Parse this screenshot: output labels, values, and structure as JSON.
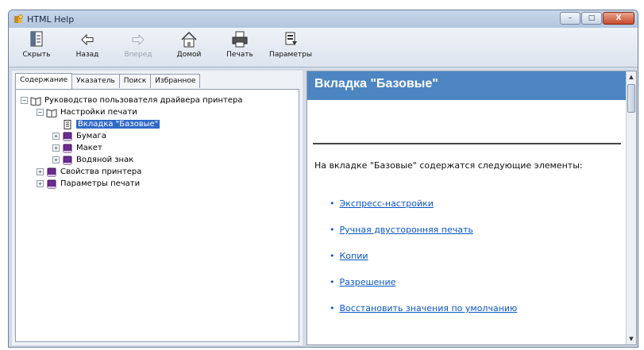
{
  "window": {
    "title": "HTML Help"
  },
  "titlebar_buttons": {
    "minimize": "–",
    "maximize": "□",
    "close": "X"
  },
  "toolbar": [
    {
      "label": "Скрыть",
      "icon": "hide-icon",
      "enabled": true
    },
    {
      "label": "Назад",
      "icon": "back-arrow-icon",
      "enabled": true
    },
    {
      "label": "Вперед",
      "icon": "forward-arrow-icon",
      "enabled": false
    },
    {
      "label": "Домой",
      "icon": "home-icon",
      "enabled": true
    },
    {
      "label": "Печать",
      "icon": "print-icon",
      "enabled": true
    },
    {
      "label": "Параметры",
      "icon": "options-icon",
      "enabled": true
    }
  ],
  "tabs": [
    {
      "label": "Содержание",
      "active": true
    },
    {
      "label": "Указатель",
      "active": false
    },
    {
      "label": "Поиск",
      "active": false
    },
    {
      "label": "Избранное",
      "active": false
    }
  ],
  "tree": [
    {
      "label": "Руководство пользователя драйвера принтера",
      "level": 0,
      "expander": "minus",
      "icon": "open-book-icon"
    },
    {
      "label": "Настройки печати",
      "level": 1,
      "expander": "minus",
      "icon": "open-book-icon"
    },
    {
      "label": "Вкладка \"Базовые\"",
      "level": 2,
      "expander": "none",
      "icon": "page-icon",
      "selected": true
    },
    {
      "label": "Бумага",
      "level": 1,
      "expander": "plus",
      "icon": "closed-book-icon"
    },
    {
      "label": "Макет",
      "level": 1,
      "expander": "plus",
      "icon": "closed-book-icon"
    },
    {
      "label": "Водяной знак",
      "level": 1,
      "expander": "plus",
      "icon": "closed-book-icon"
    },
    {
      "label": "Свойства принтера",
      "level": 0,
      "expander": "plus",
      "icon": "closed-book-icon"
    },
    {
      "label": "Параметры печати",
      "level": 0,
      "expander": "plus",
      "icon": "closed-book-icon"
    }
  ],
  "topic": {
    "title": "Вкладка \"Базовые\"",
    "intro": "На вкладке \"Базовые\" содержатся следующие элементы:",
    "links": [
      "Экспресс-настройки",
      "Ручная двусторонняя печать",
      "Копии",
      "Разрешение",
      "Восстановить значения по умолчанию"
    ]
  },
  "colors": {
    "topic_header": "#4d85c2",
    "link": "#0a55c8",
    "selection": "#3169c6",
    "book_purple": "#6b2c91"
  }
}
